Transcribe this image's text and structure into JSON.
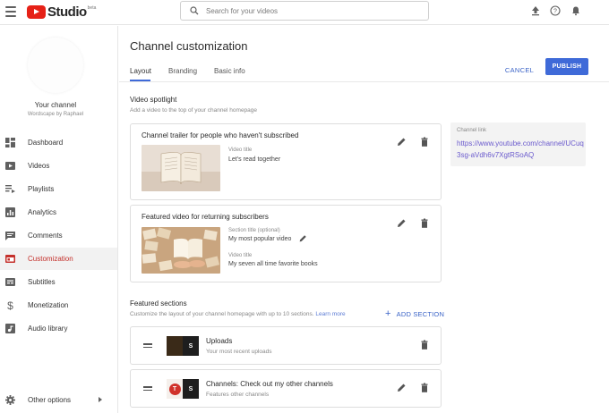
{
  "app": {
    "name": "Studio",
    "beta": "beta"
  },
  "search": {
    "placeholder": "Search for your videos",
    "value": ""
  },
  "sidebar": {
    "channel_name": "Your channel",
    "channel_subtitle": "Wordscape by Raphael",
    "items": [
      {
        "label": "Dashboard",
        "icon": "dashboard-icon"
      },
      {
        "label": "Videos",
        "icon": "videos-icon"
      },
      {
        "label": "Playlists",
        "icon": "playlists-icon"
      },
      {
        "label": "Analytics",
        "icon": "analytics-icon"
      },
      {
        "label": "Comments",
        "icon": "comments-icon"
      },
      {
        "label": "Customization",
        "icon": "customization-icon",
        "active": true
      },
      {
        "label": "Subtitles",
        "icon": "subtitles-icon"
      },
      {
        "label": "Monetization",
        "icon": "monetization-icon"
      },
      {
        "label": "Audio library",
        "icon": "audio-library-icon"
      }
    ],
    "other_options": "Other options"
  },
  "header": {
    "title": "Channel customization",
    "tabs": [
      {
        "label": "Layout",
        "active": true
      },
      {
        "label": "Branding"
      },
      {
        "label": "Basic info"
      }
    ],
    "cancel_label": "CANCEL",
    "publish_label": "PUBLISH"
  },
  "video_spotlight": {
    "title": "Video spotlight",
    "description": "Add a video to the top of your channel homepage",
    "trailer": {
      "title": "Channel trailer for people who haven't subscribed",
      "video_title_label": "Video title",
      "video_title": "Let's read together"
    },
    "featured": {
      "title": "Featured video for returning subscribers",
      "section_title_label": "Section title (optional)",
      "section_title": "My most popular video",
      "video_title_label": "Video title",
      "video_title": "My seven all time favorite books"
    }
  },
  "channel_link": {
    "label": "Channel link",
    "url": "https://www.youtube.com/channel/UCuq3sg-aVdh6v7XgtRSoAQ"
  },
  "featured_sections": {
    "title": "Featured sections",
    "description": "Customize the layout of your channel homepage with up to 10 sections.",
    "learn_more": "Learn more",
    "add_section": "ADD SECTION",
    "sections": [
      {
        "title": "Uploads",
        "subtitle": "Your most recent uploads",
        "thumb_letter": "S"
      },
      {
        "title": "Channels: Check out my other channels",
        "subtitle": "Features other channels",
        "thumb_letter": "S",
        "avatar_letter": "T"
      }
    ]
  },
  "colors": {
    "accent": "#3f6ad8",
    "brand_red": "#e62117",
    "active_nav": "#c4302b",
    "link": "#6a5acd"
  }
}
